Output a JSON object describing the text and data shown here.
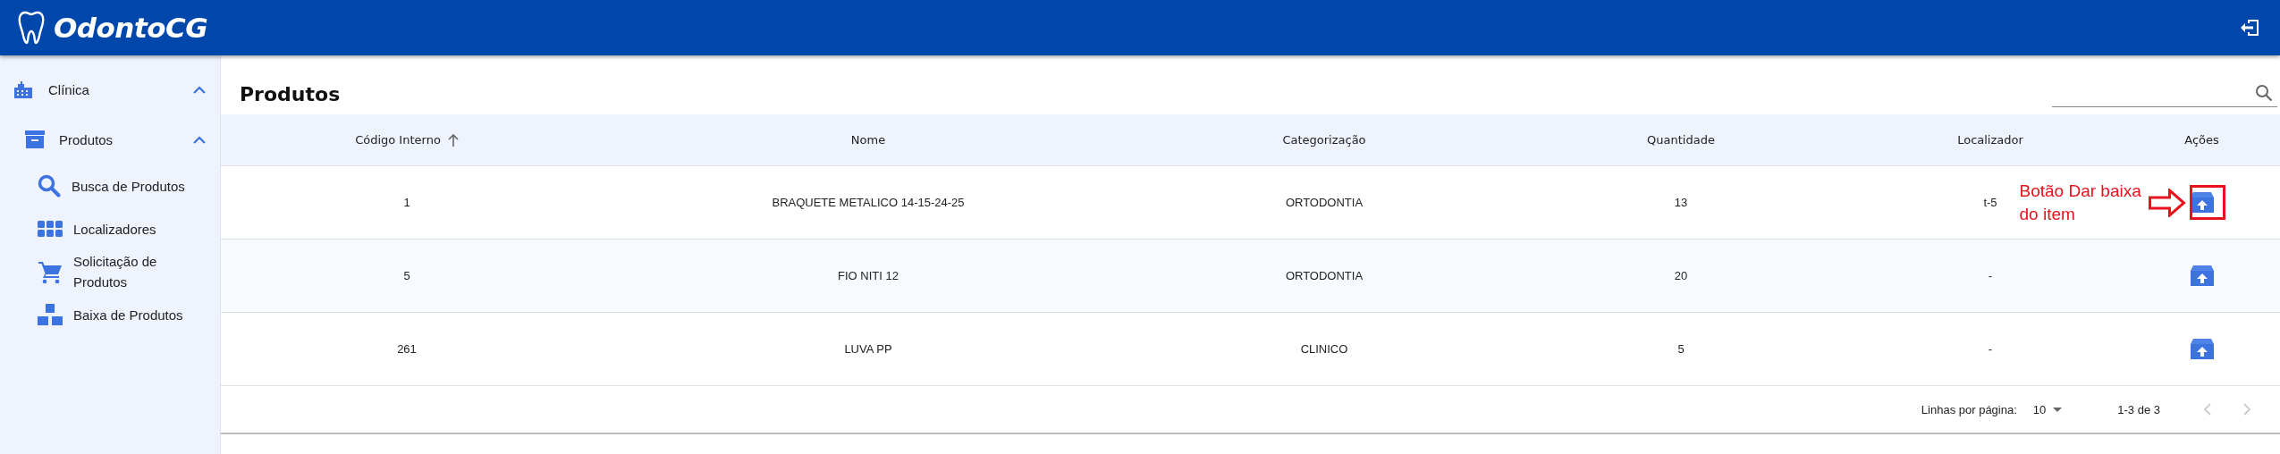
{
  "app_bar": {
    "title": "OdontoCG"
  },
  "sidebar": {
    "items": [
      {
        "label": "Clínica",
        "kind": "building",
        "expanded": true,
        "children": [
          {
            "label": "Produtos",
            "kind": "archive",
            "expanded": true,
            "children": [
              {
                "label": "Busca de Produtos",
                "kind": "search"
              },
              {
                "label": "Localizadores",
                "kind": "grid"
              },
              {
                "label": "Solicitação de Produtos",
                "kind": "cart"
              },
              {
                "label": "Baixa de Produtos",
                "kind": "boxes"
              }
            ]
          }
        ]
      }
    ]
  },
  "page": {
    "title": "Produtos"
  },
  "table": {
    "columns": [
      {
        "label": "Código Interno",
        "sorted": true
      },
      {
        "label": "Nome",
        "sorted": false
      },
      {
        "label": "Categorização",
        "sorted": false
      },
      {
        "label": "Quantidade",
        "sorted": false
      },
      {
        "label": "Localizador",
        "sorted": false
      },
      {
        "label": "Ações",
        "sorted": false
      }
    ],
    "rows": [
      {
        "cells": [
          "1",
          "BRAQUETE METALICO 14-15-24-25",
          "ORTODONTIA",
          "13",
          "t-5"
        ],
        "annotation": "Botão Dar baixa do item"
      },
      {
        "cells": [
          "5",
          "FIO NITI 12",
          "ORTODONTIA",
          "20",
          "-"
        ]
      },
      {
        "cells": [
          "261",
          "LUVA PP",
          "CLINICO",
          "5",
          "-"
        ]
      }
    ]
  },
  "pagination": {
    "rows_label": "Linhas por página:",
    "rows_per_page": "10",
    "range": "1-3 de 3",
    "prev_disabled": true,
    "next_disabled": true
  }
}
